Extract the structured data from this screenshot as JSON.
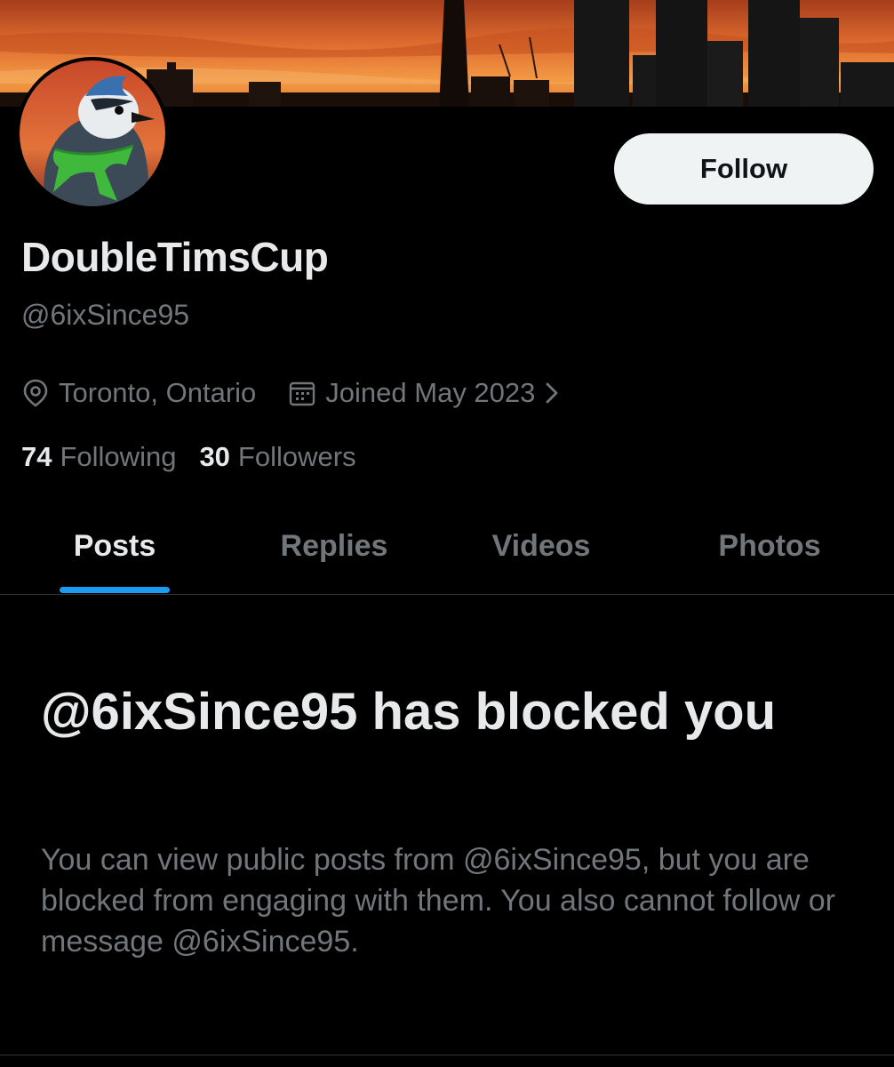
{
  "profile": {
    "display_name": "DoubleTimsCup",
    "handle": "@6ixSince95",
    "location": "Toronto, Ontario",
    "joined": "Joined May 2023",
    "following_count": "74",
    "following_label": "Following",
    "followers_count": "30",
    "followers_label": "Followers"
  },
  "actions": {
    "follow_label": "Follow"
  },
  "tabs": [
    {
      "label": "Posts",
      "active": true
    },
    {
      "label": "Replies",
      "active": false
    },
    {
      "label": "Videos",
      "active": false
    },
    {
      "label": "Photos",
      "active": false
    }
  ],
  "blocked": {
    "title": "@6ixSince95 has blocked you",
    "body": "You can view public posts from @6ixSince95, but you are blocked from engaging with them. You also cannot follow or message @6ixSince95."
  },
  "icons": {
    "location": "map-pin-icon",
    "joined": "calendar-icon",
    "chevron": "chevron-right-icon"
  },
  "colors": {
    "accent": "#1d9bf0",
    "background": "#000000",
    "primary_text": "#e7e9ea",
    "secondary_text": "#71767b",
    "follow_button_bg": "#eff3f4"
  }
}
